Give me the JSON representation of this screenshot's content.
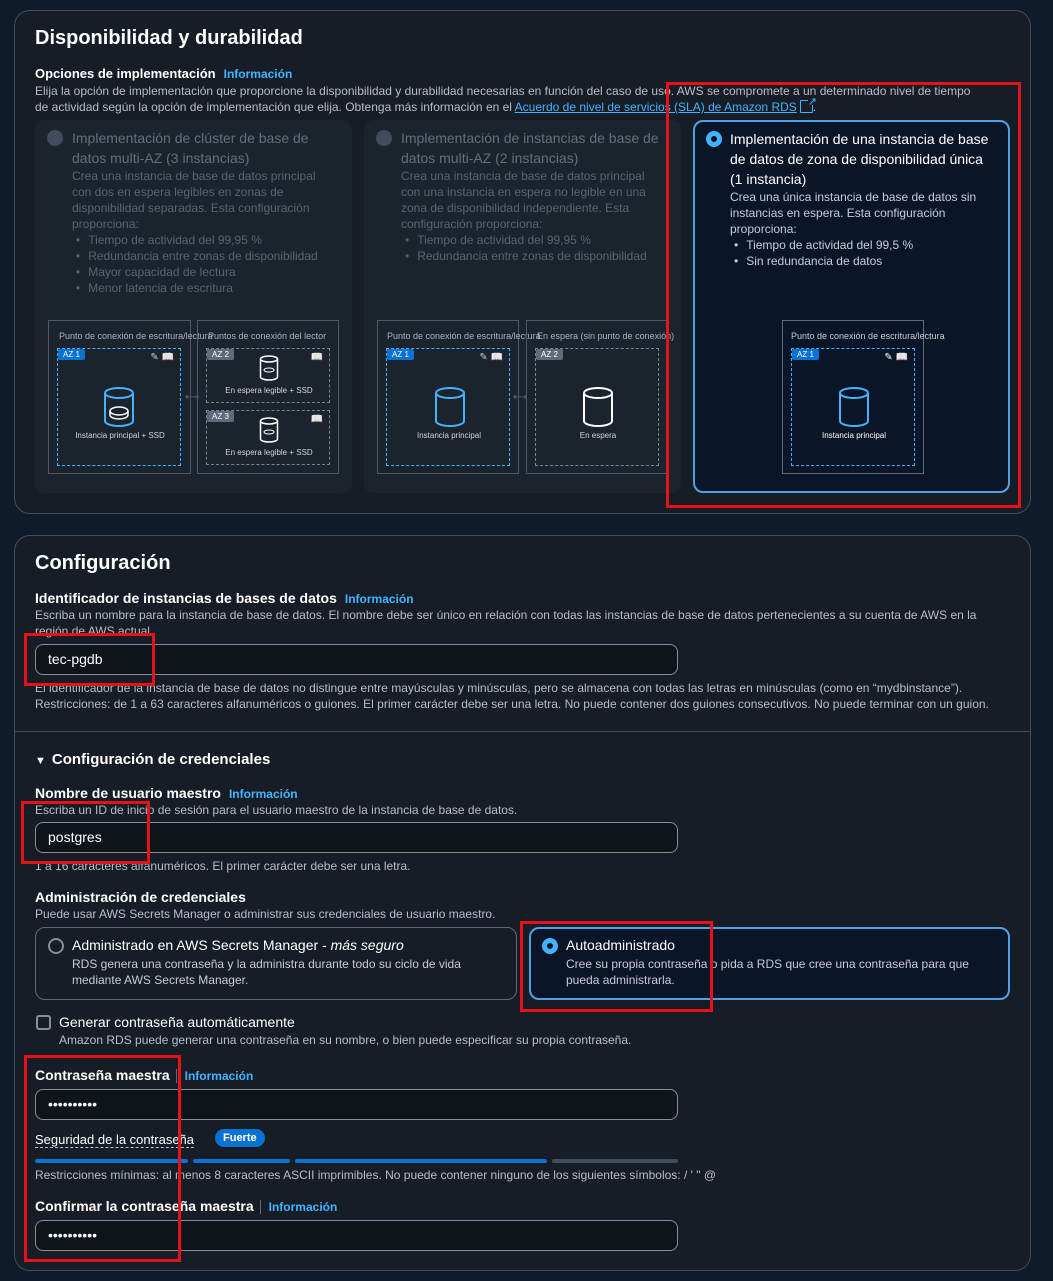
{
  "availability": {
    "title": "Disponibilidad y durabilidad",
    "deploy_label": "Opciones de implementación",
    "info": "Información",
    "desc_line1": "Elija la opción de implementación que proporcione la disponibilidad y durabilidad necesarias en función del caso de uso. AWS se compromete a un determinado nivel de tiempo",
    "desc_line2": "de actividad según la opción de implementación que elija. Obtenga más información en el ",
    "sla_link": "Acuerdo de nivel de servicios (SLA) de Amazon RDS",
    "cards": [
      {
        "title_l1": "Implementación de clúster de base de",
        "title_l2": "datos multi-AZ (3 instancias)",
        "desc": [
          "Crea una instancia de base de datos principal",
          "con dos en espera legibles en zonas de",
          "disponibilidad separadas. Esta configuración",
          "proporciona:"
        ],
        "bullets": [
          "Tiempo de actividad del 99,95 %",
          "Redundancia entre zonas de disponibilidad",
          "Mayor capacidad de lectura",
          "Menor latencia de escritura"
        ],
        "diag": {
          "left_label": "Punto de conexión de escritura/lectura",
          "right_label": "Puntos de conexión del lector",
          "az1": "AZ 1",
          "az2": "AZ 2",
          "az3": "AZ 3",
          "primary": "Instancia principal + SSD",
          "standby1": "En espera legible + SSD",
          "standby2": "En espera legible + SSD"
        }
      },
      {
        "title_l1": "Implementación de instancias de base de",
        "title_l2": "datos multi-AZ (2 instancias)",
        "desc": [
          "Crea una instancia de base de datos principal",
          "con una instancia en espera no legible en una",
          "zona de disponibilidad independiente. Esta",
          "configuración proporciona:"
        ],
        "bullets": [
          "Tiempo de actividad del 99,95 %",
          "Redundancia entre zonas de disponibilidad"
        ],
        "diag": {
          "left_label": "Punto de conexión de escritura/lectura",
          "right_label": "En espera (sin punto de conexión)",
          "az1": "AZ 1",
          "az2": "AZ 2",
          "primary": "Instancia principal",
          "standby": "En espera"
        }
      },
      {
        "title_l1": "Implementación de una instancia de base",
        "title_l2": "de datos de zona de disponibilidad única",
        "title_l3": "(1 instancia)",
        "desc": [
          "Crea una única instancia de base de datos sin",
          "instancias en espera. Esta configuración",
          "proporciona:"
        ],
        "bullets": [
          "Tiempo de actividad del 99,5 %",
          "Sin redundancia de datos"
        ],
        "diag": {
          "label": "Punto de conexión de escritura/lectura",
          "az1": "AZ 1",
          "primary": "Instancia principal"
        }
      }
    ]
  },
  "config": {
    "title": "Configuración",
    "id_label": "Identificador de instancias de bases de datos",
    "info": "Información",
    "id_desc_l1": "Escriba un nombre para la instancia de base de datos. El nombre debe ser único en relación con todas las instancias de base de datos pertenecientes a su cuenta de AWS en la",
    "id_desc_l2": "región de AWS actual.",
    "id_value": "tec-pgdb",
    "id_hint_l1": "El identificador de la instancia de base de datos no distingue entre mayúsculas y minúsculas, pero se almacena con todas las letras en minúsculas (como en “mydbinstance”).",
    "id_hint_l2": "Restricciones: de 1 a 63 caracteres alfanuméricos o guiones. El primer carácter debe ser una letra. No puede contener dos guiones consecutivos. No puede terminar con un guion.",
    "cred_section": "Configuración de credenciales",
    "user_label": "Nombre de usuario maestro",
    "user_desc": "Escriba un ID de inicio de sesión para el usuario maestro de la instancia de base de datos.",
    "user_value": "postgres",
    "user_hint": "1 a 16 caracteres alfanuméricos. El primer carácter debe ser una letra.",
    "admin_label": "Administración de credenciales",
    "admin_desc": "Puede usar AWS Secrets Manager o administrar sus credenciales de usuario maestro.",
    "opt1_title": "Administrado en AWS Secrets Manager - ",
    "opt1_italic": "más seguro",
    "opt1_desc_l1": "RDS genera una contraseña y la administra durante todo su ciclo de vida",
    "opt1_desc_l2": "mediante AWS Secrets Manager.",
    "opt2_title": "Autoadministrado",
    "opt2_desc_l1": "Cree su propia contraseña o pida a RDS que cree una contraseña para que",
    "opt2_desc_l2": "pueda administrarla.",
    "gen_label": "Generar contraseña automáticamente",
    "gen_desc": "Amazon RDS puede generar una contraseña en su nombre, o bien puede especificar su propia contraseña.",
    "pwd_label": "Contraseña maestra",
    "pwd_value": "••••••••••",
    "strength_label": "Seguridad de la contraseña",
    "strength_badge": "Fuerte",
    "strength_level": 1.0,
    "pwd_hint": "Restricciones mínimas: al menos 8 caracteres ASCII imprimibles. No puede contener ninguno de los siguientes símbolos: / ' \" @",
    "confirm_label": "Confirmar la contraseña maestra",
    "confirm_value": "••••••••••"
  }
}
